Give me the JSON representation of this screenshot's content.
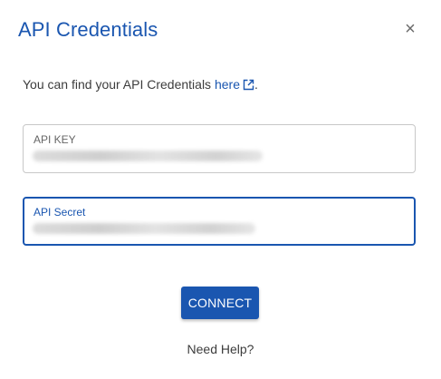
{
  "dialog": {
    "title": "API Credentials",
    "close_label": "×",
    "intro_text": "You can find your API Credentials ",
    "intro_link": "here",
    "intro_suffix": "."
  },
  "fields": {
    "api_key": {
      "label": "API KEY"
    },
    "api_secret": {
      "label": "API Secret"
    }
  },
  "actions": {
    "connect_label": "CONNECT",
    "help_label": "Need Help?"
  },
  "colors": {
    "accent": "#1a56b0",
    "text": "#3c3c3c"
  }
}
